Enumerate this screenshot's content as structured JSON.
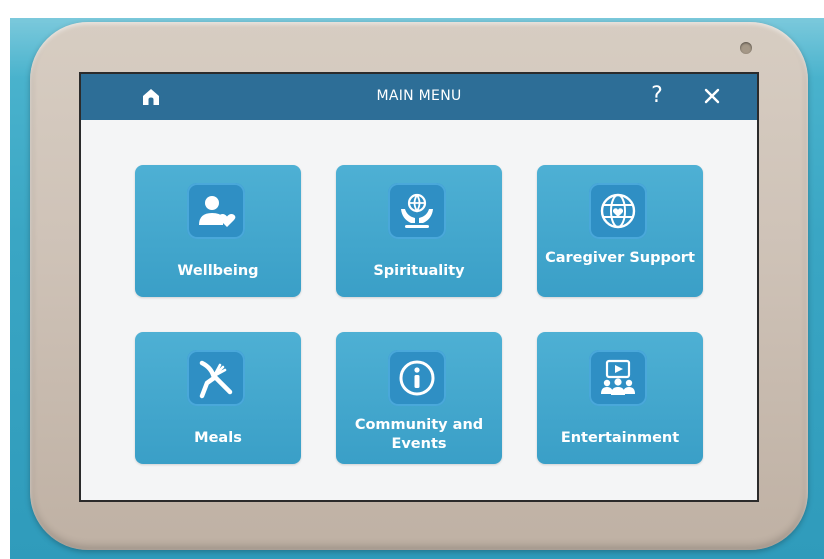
{
  "header": {
    "title": "MAIN MENU",
    "help_label": "?",
    "home_icon": "home-icon",
    "close_icon": "close-icon"
  },
  "tiles": [
    {
      "label": "Wellbeing",
      "icon": "person-heart-icon"
    },
    {
      "label": "Spirituality",
      "icon": "hands-globe-icon"
    },
    {
      "label": "Caregiver Support",
      "icon": "globe-heart-icon"
    },
    {
      "label": "Meals",
      "icon": "fork-knife-icon"
    },
    {
      "label": "Community and Events",
      "icon": "info-icon"
    },
    {
      "label": "Entertainment",
      "icon": "video-group-icon"
    }
  ],
  "colors": {
    "header_bar": "#2d6e97",
    "tile": "#3fa5cc",
    "icon_box": "#2f8fc4",
    "screen_bg": "#f4f5f6",
    "device_bezel": "#cfc3b8"
  }
}
